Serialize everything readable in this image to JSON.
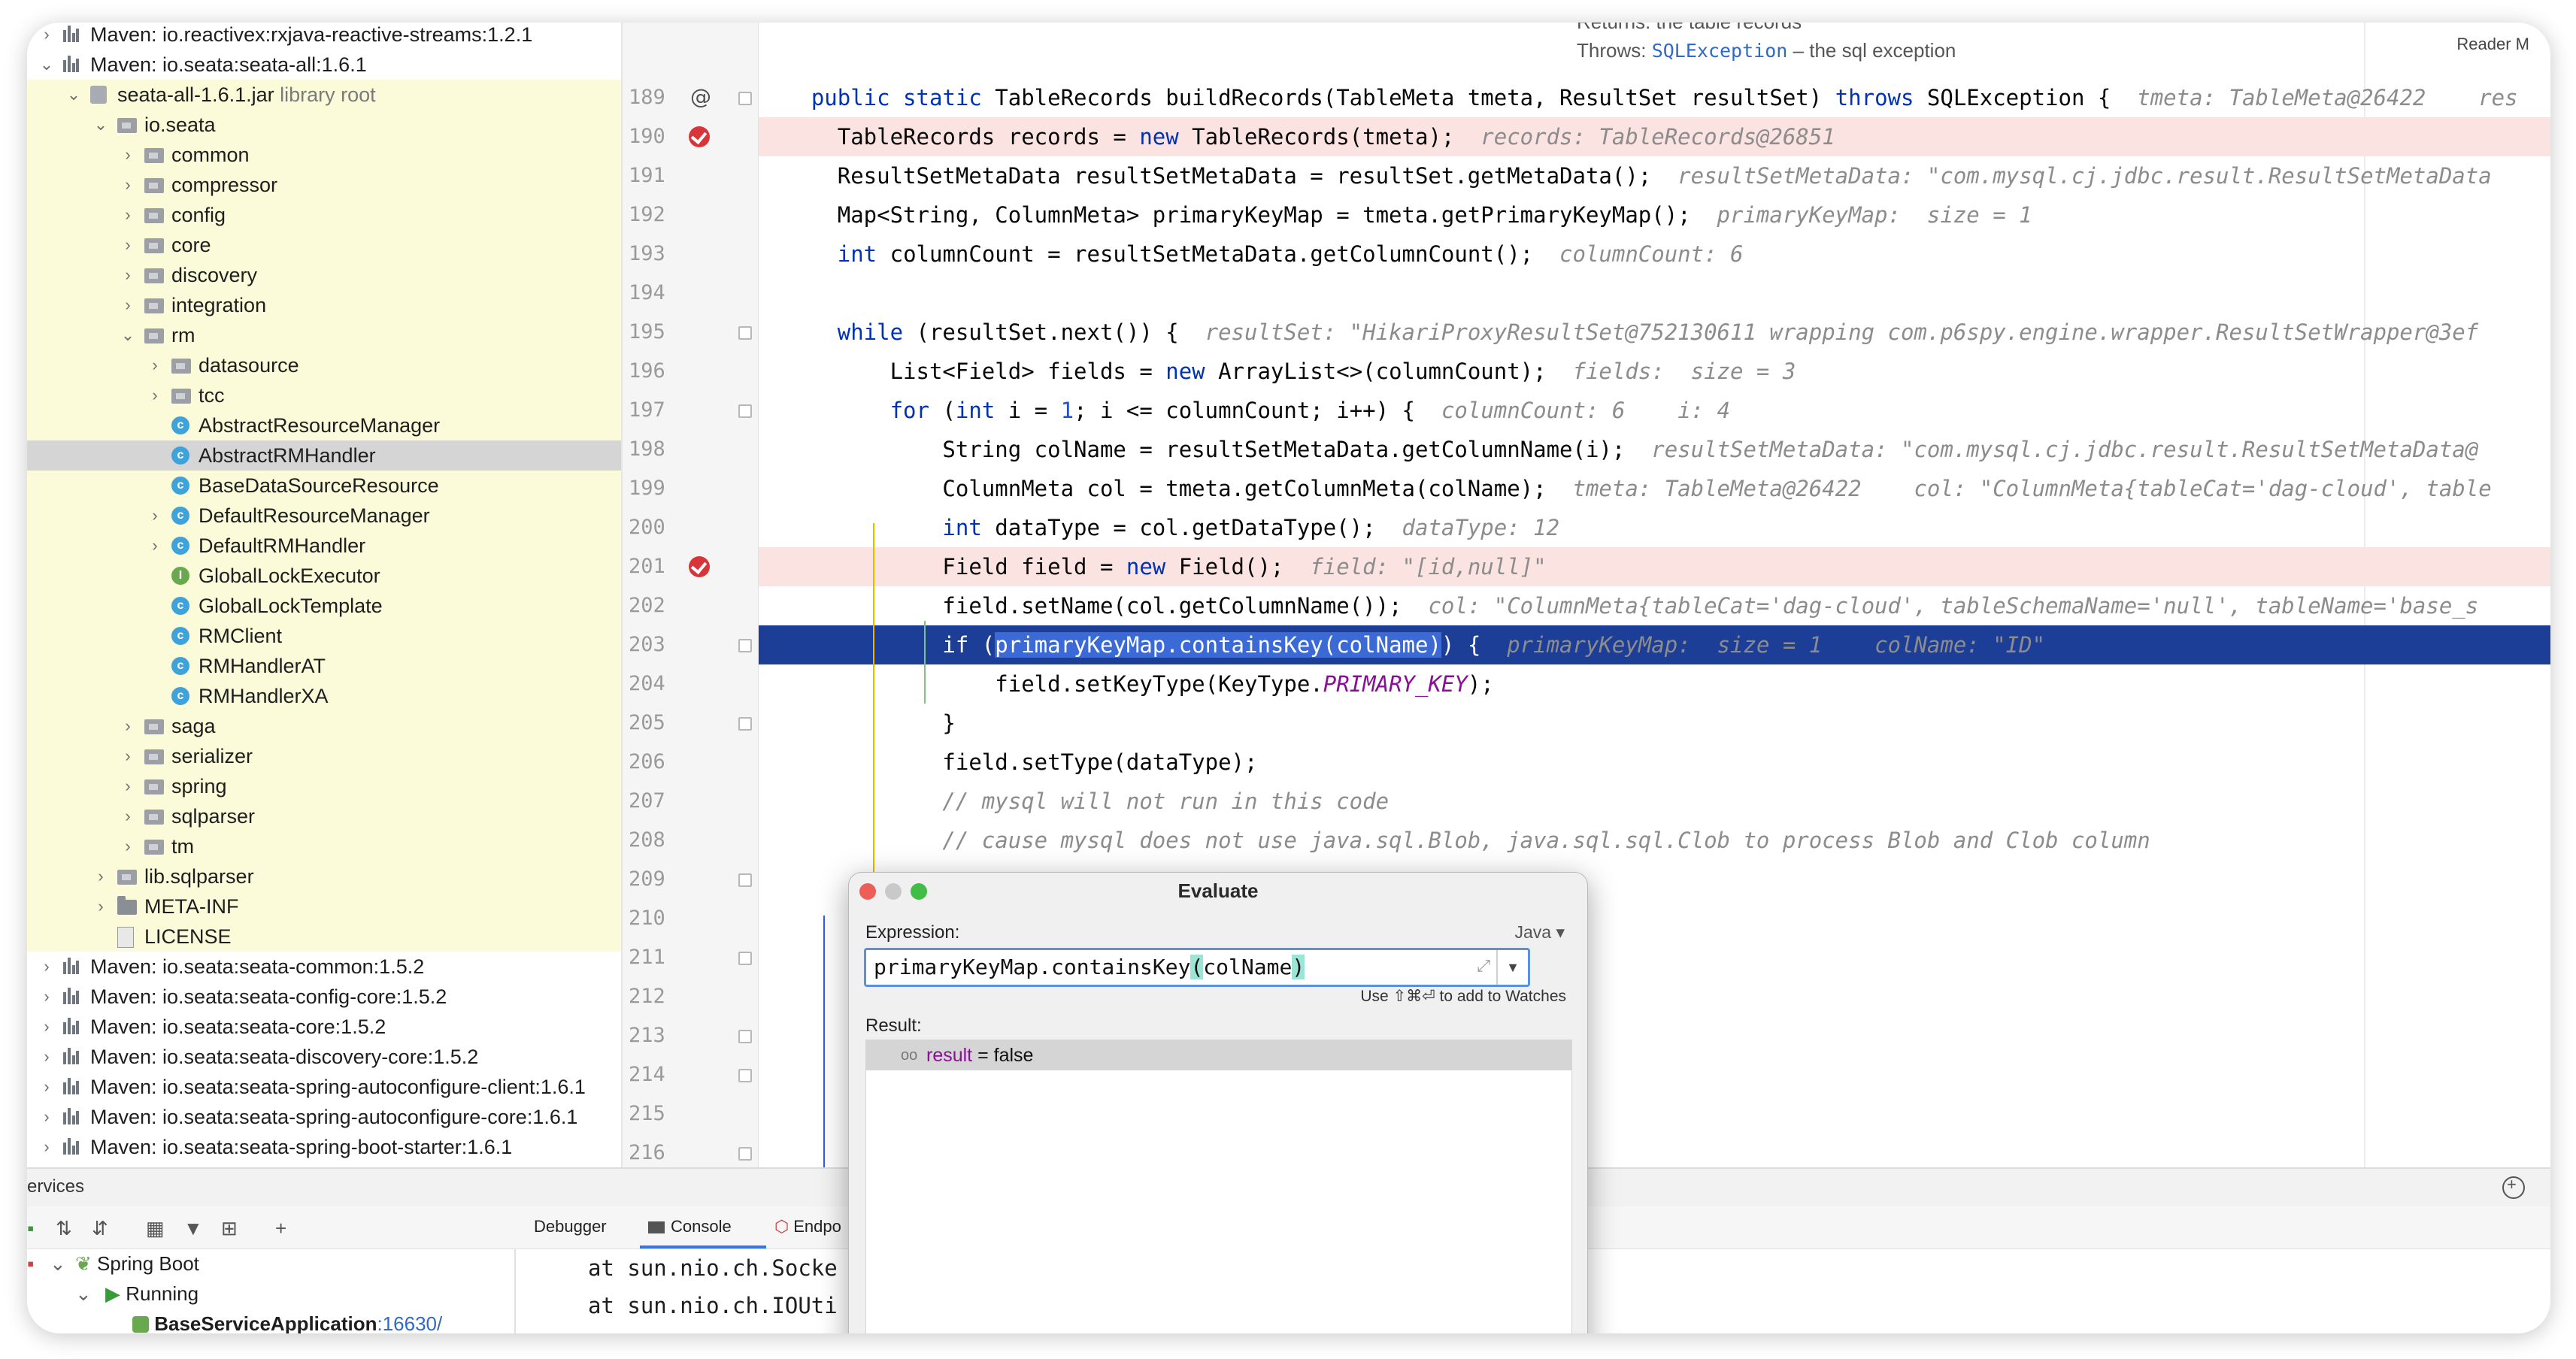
{
  "tree": [
    {
      "label": "Maven: io.reactivex:rxjava-reactive-streams:1.2.1",
      "icon": "library-icon",
      "indent": 0,
      "arrow": "›",
      "style": ""
    },
    {
      "label": "Maven: io.seata:seata-all:1.6.1",
      "icon": "library-icon",
      "indent": 0,
      "arrow": "⌄",
      "style": ""
    },
    {
      "label": "seata-all-1.6.1.jar",
      "sub": "library root",
      "icon": "jar-icon",
      "indent": 1,
      "arrow": "⌄",
      "style": "yel"
    },
    {
      "label": "io.seata",
      "icon": "package-icon",
      "indent": 2,
      "arrow": "⌄",
      "style": "yel"
    },
    {
      "label": "common",
      "icon": "package-icon",
      "indent": 3,
      "arrow": "›",
      "style": "yel"
    },
    {
      "label": "compressor",
      "icon": "package-icon",
      "indent": 3,
      "arrow": "›",
      "style": "yel"
    },
    {
      "label": "config",
      "icon": "package-icon",
      "indent": 3,
      "arrow": "›",
      "style": "yel"
    },
    {
      "label": "core",
      "icon": "package-icon",
      "indent": 3,
      "arrow": "›",
      "style": "yel"
    },
    {
      "label": "discovery",
      "icon": "package-icon",
      "indent": 3,
      "arrow": "›",
      "style": "yel"
    },
    {
      "label": "integration",
      "icon": "package-icon",
      "indent": 3,
      "arrow": "›",
      "style": "yel"
    },
    {
      "label": "rm",
      "icon": "package-icon",
      "indent": 3,
      "arrow": "⌄",
      "style": "yel"
    },
    {
      "label": "datasource",
      "icon": "package-icon",
      "indent": 4,
      "arrow": "›",
      "style": "yel"
    },
    {
      "label": "tcc",
      "icon": "package-icon",
      "indent": 4,
      "arrow": "›",
      "style": "yel"
    },
    {
      "label": "AbstractResourceManager",
      "icon": "class-icon",
      "indent": 4,
      "arrow": "",
      "style": "yel"
    },
    {
      "label": "AbstractRMHandler",
      "icon": "class-icon",
      "indent": 4,
      "arrow": "",
      "style": "sel"
    },
    {
      "label": "BaseDataSourceResource",
      "icon": "class-icon",
      "indent": 4,
      "arrow": "",
      "style": "yel"
    },
    {
      "label": "DefaultResourceManager",
      "icon": "class-icon",
      "indent": 4,
      "arrow": "›",
      "style": "yel"
    },
    {
      "label": "DefaultRMHandler",
      "icon": "class-icon",
      "indent": 4,
      "arrow": "›",
      "style": "yel"
    },
    {
      "label": "GlobalLockExecutor",
      "icon": "interface-icon",
      "indent": 4,
      "arrow": "",
      "style": "yel"
    },
    {
      "label": "GlobalLockTemplate",
      "icon": "class-icon",
      "indent": 4,
      "arrow": "",
      "style": "yel"
    },
    {
      "label": "RMClient",
      "icon": "class-icon",
      "indent": 4,
      "arrow": "",
      "style": "yel"
    },
    {
      "label": "RMHandlerAT",
      "icon": "class-icon",
      "indent": 4,
      "arrow": "",
      "style": "yel"
    },
    {
      "label": "RMHandlerXA",
      "icon": "class-icon",
      "indent": 4,
      "arrow": "",
      "style": "yel"
    },
    {
      "label": "saga",
      "icon": "package-icon",
      "indent": 3,
      "arrow": "›",
      "style": "yel"
    },
    {
      "label": "serializer",
      "icon": "package-icon",
      "indent": 3,
      "arrow": "›",
      "style": "yel"
    },
    {
      "label": "spring",
      "icon": "package-icon",
      "indent": 3,
      "arrow": "›",
      "style": "yel"
    },
    {
      "label": "sqlparser",
      "icon": "package-icon",
      "indent": 3,
      "arrow": "›",
      "style": "yel"
    },
    {
      "label": "tm",
      "icon": "package-icon",
      "indent": 3,
      "arrow": "›",
      "style": "yel"
    },
    {
      "label": "lib.sqlparser",
      "icon": "package-icon",
      "indent": 2,
      "arrow": "›",
      "style": "yel"
    },
    {
      "label": "META-INF",
      "icon": "folder-icon",
      "indent": 2,
      "arrow": "›",
      "style": "yel"
    },
    {
      "label": "LICENSE",
      "icon": "file-icon",
      "indent": 2,
      "arrow": "",
      "style": "yel"
    },
    {
      "label": "Maven: io.seata:seata-common:1.5.2",
      "icon": "library-icon",
      "indent": 0,
      "arrow": "›",
      "style": ""
    },
    {
      "label": "Maven: io.seata:seata-config-core:1.5.2",
      "icon": "library-icon",
      "indent": 0,
      "arrow": "›",
      "style": ""
    },
    {
      "label": "Maven: io.seata:seata-core:1.5.2",
      "icon": "library-icon",
      "indent": 0,
      "arrow": "›",
      "style": ""
    },
    {
      "label": "Maven: io.seata:seata-discovery-core:1.5.2",
      "icon": "library-icon",
      "indent": 0,
      "arrow": "›",
      "style": ""
    },
    {
      "label": "Maven: io.seata:seata-spring-autoconfigure-client:1.6.1",
      "icon": "library-icon",
      "indent": 0,
      "arrow": "›",
      "style": ""
    },
    {
      "label": "Maven: io.seata:seata-spring-autoconfigure-core:1.6.1",
      "icon": "library-icon",
      "indent": 0,
      "arrow": "›",
      "style": ""
    },
    {
      "label": "Maven: io.seata:seata-spring-boot-starter:1.6.1",
      "icon": "library-icon",
      "indent": 0,
      "arrow": "›",
      "style": ""
    }
  ],
  "doc": {
    "returns": "Returns: the table records",
    "throws_label": "Throws:",
    "throws_link": "SQLException",
    "throws_desc": " – the sql exception",
    "reader_mode": "Reader M"
  },
  "code": [
    {
      "n": "189",
      "segs": [
        [
          "",
          "    "
        ],
        [
          "kw",
          "public static "
        ],
        [
          "",
          "TableRecords buildRecords(TableMeta tmeta, ResultSet resultSet) "
        ],
        [
          "kw",
          "throws "
        ],
        [
          "",
          "SQLException {  "
        ],
        [
          "hint",
          "tmeta: TableMeta@26422    res"
        ]
      ],
      "mark": "at"
    },
    {
      "n": "190",
      "segs": [
        [
          "",
          "      TableRecords records = "
        ],
        [
          "kw",
          "new "
        ],
        [
          "",
          "TableRecords(tmeta);  "
        ],
        [
          "hint",
          "records: TableRecords@26851"
        ]
      ],
      "mark": "bp",
      "bg": "bp"
    },
    {
      "n": "191",
      "segs": [
        [
          "",
          "      ResultSetMetaData resultSetMetaData = resultSet.getMetaData();  "
        ],
        [
          "hint",
          "resultSetMetaData: \"com.mysql.cj.jdbc.result.ResultSetMetaData"
        ]
      ]
    },
    {
      "n": "192",
      "segs": [
        [
          "",
          "      Map<String, ColumnMeta> primaryKeyMap = tmeta.getPrimaryKeyMap();  "
        ],
        [
          "hint",
          "primaryKeyMap:  size = 1"
        ]
      ]
    },
    {
      "n": "193",
      "segs": [
        [
          "kw",
          "      int "
        ],
        [
          "",
          "columnCount = resultSetMetaData.getColumnCount();  "
        ],
        [
          "hint",
          "columnCount: 6"
        ]
      ]
    },
    {
      "n": "194",
      "segs": [
        [
          "",
          ""
        ]
      ]
    },
    {
      "n": "195",
      "segs": [
        [
          "kw",
          "      while "
        ],
        [
          "",
          "(resultSet.next()) {  "
        ],
        [
          "hint",
          "resultSet: \"HikariProxyResultSet@752130611 wrapping com.p6spy.engine.wrapper.ResultSetWrapper@3ef"
        ]
      ],
      "mark": "fold"
    },
    {
      "n": "196",
      "segs": [
        [
          "",
          "          List<Field> fields = "
        ],
        [
          "kw",
          "new "
        ],
        [
          "",
          "ArrayList<>(columnCount);  "
        ],
        [
          "hint",
          "fields:  size = 3"
        ]
      ]
    },
    {
      "n": "197",
      "segs": [
        [
          "kw",
          "          for "
        ],
        [
          "",
          "("
        ],
        [
          "kw",
          "int "
        ],
        [
          "",
          "i = "
        ],
        [
          "num",
          "1"
        ],
        [
          "",
          "; i <= columnCount; i++) {  "
        ],
        [
          "hint",
          "columnCount: 6    i: 4"
        ]
      ],
      "mark": "fold"
    },
    {
      "n": "198",
      "segs": [
        [
          "",
          "              String colName = resultSetMetaData.getColumnName(i);  "
        ],
        [
          "hint",
          "resultSetMetaData: \"com.mysql.cj.jdbc.result.ResultSetMetaData@"
        ]
      ]
    },
    {
      "n": "199",
      "segs": [
        [
          "",
          "              ColumnMeta col = tmeta.getColumnMeta(colName);  "
        ],
        [
          "hint",
          "tmeta: TableMeta@26422    col: \"ColumnMeta{tableCat='dag-cloud', table"
        ]
      ]
    },
    {
      "n": "200",
      "segs": [
        [
          "kw",
          "              int "
        ],
        [
          "",
          "dataType = col.getDataType();  "
        ],
        [
          "hint",
          "dataType: 12"
        ]
      ]
    },
    {
      "n": "201",
      "segs": [
        [
          "",
          "              Field field = "
        ],
        [
          "kw",
          "new "
        ],
        [
          "",
          "Field();  "
        ],
        [
          "hint",
          "field: \"[id,null]\""
        ]
      ],
      "mark": "bp",
      "bg": "bp"
    },
    {
      "n": "202",
      "segs": [
        [
          "",
          "              field.setName(col.getColumnName());  "
        ],
        [
          "hint",
          "col: \"ColumnMeta{tableCat='dag-cloud', tableSchemaName='null', tableName='base_s"
        ]
      ]
    },
    {
      "n": "203",
      "segs": [
        [
          "",
          "              if ("
        ],
        [
          "sel-frag",
          "primaryKeyMap.containsKey(colName)"
        ],
        [
          "",
          ") {  "
        ],
        [
          "hint",
          "primaryKeyMap:  size = 1    colName: \"ID\""
        ]
      ],
      "bg": "cur",
      "mark": "fold"
    },
    {
      "n": "204",
      "segs": [
        [
          "",
          "                  field.setKeyType(KeyType."
        ],
        [
          "cst",
          "PRIMARY_KEY"
        ],
        [
          "",
          ");"
        ]
      ]
    },
    {
      "n": "205",
      "segs": [
        [
          "",
          "              }"
        ]
      ],
      "mark": "fold"
    },
    {
      "n": "206",
      "segs": [
        [
          "",
          "              field.setType(dataType);"
        ]
      ]
    },
    {
      "n": "207",
      "segs": [
        [
          "cmt",
          "              // mysql will not run in this code"
        ]
      ]
    },
    {
      "n": "208",
      "segs": [
        [
          "cmt",
          "              // cause mysql does not use java.sql.Blob, java.sql.sql.Clob to process Blob and Clob column"
        ]
      ]
    },
    {
      "n": "209",
      "segs": [
        [
          "",
          ""
        ]
      ],
      "mark": "fold"
    },
    {
      "n": "210",
      "segs": [
        [
          "",
          ""
        ]
      ]
    },
    {
      "n": "211",
      "segs": [
        [
          "",
          ""
        ]
      ],
      "mark": "fold"
    },
    {
      "n": "212",
      "segs": [
        [
          "",
          "                                              ;"
        ]
      ]
    },
    {
      "n": "213",
      "segs": [
        [
          "",
          ""
        ]
      ],
      "mark": "fold"
    },
    {
      "n": "214",
      "segs": [
        [
          "",
          ""
        ]
      ],
      "mark": "fold"
    },
    {
      "n": "215",
      "segs": [
        [
          "",
          ""
        ]
      ]
    },
    {
      "n": "216",
      "segs": [
        [
          "",
          ""
        ]
      ],
      "mark": "fold"
    }
  ],
  "services": {
    "title": "ervices",
    "tabs": [
      "Debugger",
      "Console",
      "Endpo"
    ],
    "tree": [
      {
        "label": "Spring Boot",
        "icon": "spring-icon"
      },
      {
        "label": "Running",
        "icon": "run-icon"
      },
      {
        "label": "BaseServiceApplication",
        "port": ":16630/",
        "icon": "app-icon"
      }
    ],
    "console": [
      "at sun.nio.ch.Socke",
      "at sun.nio.ch.IOUti"
    ]
  },
  "evaluate": {
    "title": "Evaluate",
    "expression_label": "Expression:",
    "language": "Java",
    "expression_pre": "primaryKeyMap.containsKey",
    "expression_paren_open": "(",
    "expression_arg": "colName",
    "expression_paren_close": ")",
    "watch_hint": "Use ⇧⌘⏎ to add to Watches",
    "result_label": "Result:",
    "result_name": "result",
    "result_rest": " = false"
  },
  "colors": {
    "accent": "#3574f0",
    "current_line": "#1d3e96",
    "breakpoint": "#d9343a",
    "keyword": "#0033b3",
    "tree_highlight": "#fbfbd9"
  }
}
